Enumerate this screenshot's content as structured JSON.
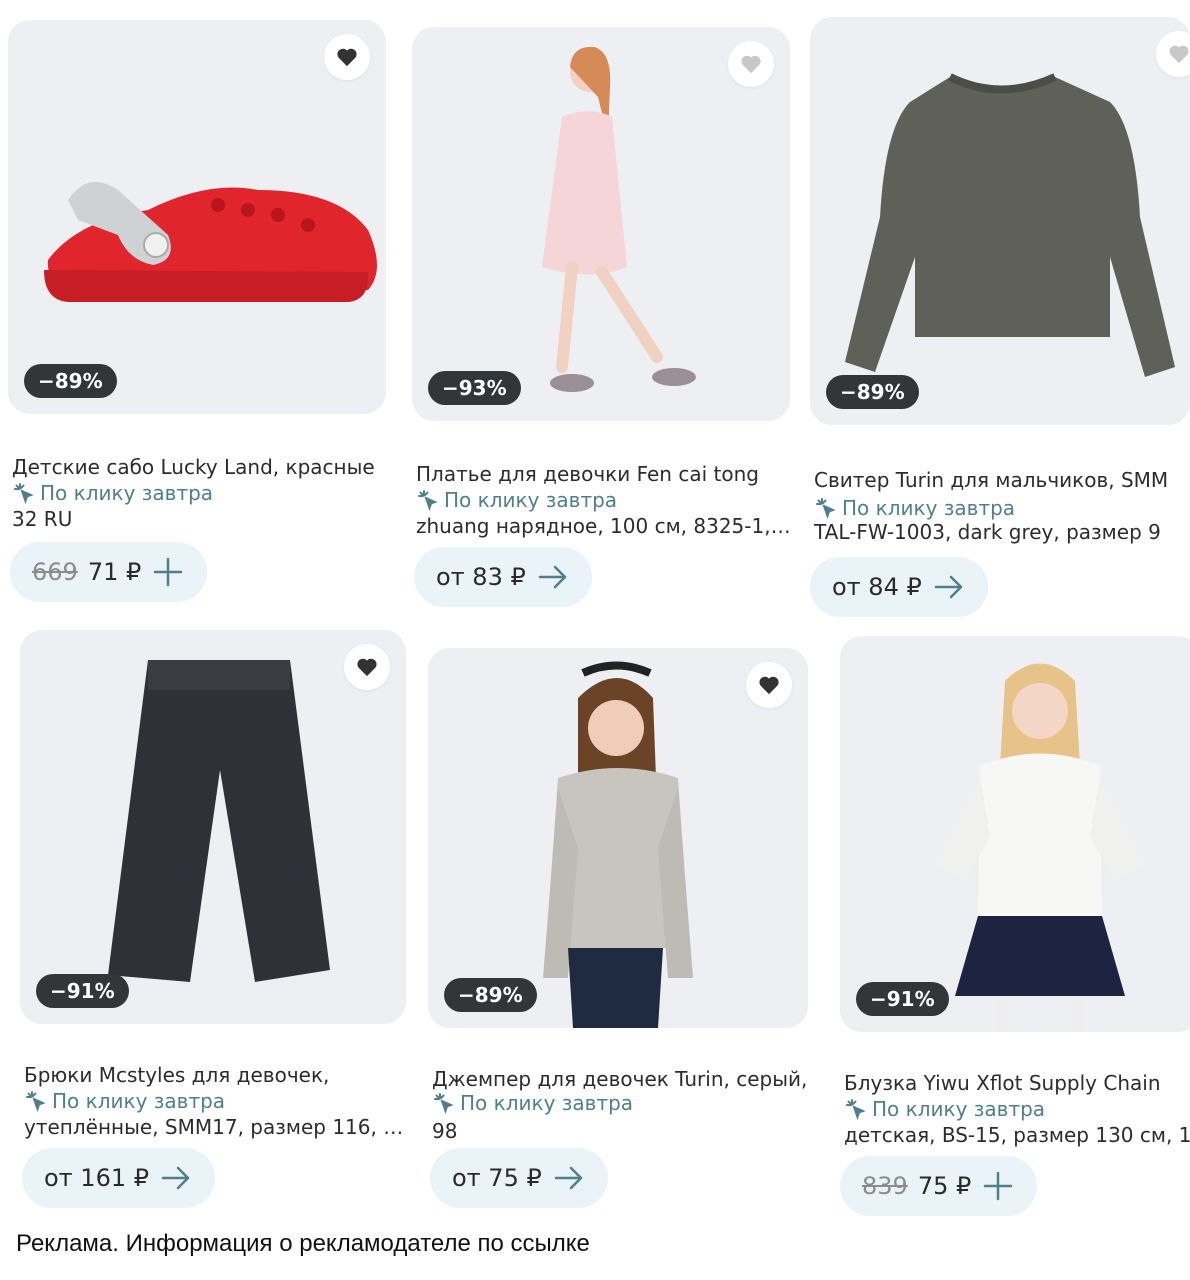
{
  "products": [
    {
      "discount": "−89%",
      "title_lines": [
        "Детские сабо Lucky Land, красные",
        "32 RU"
      ],
      "delivery": "По клику завтра",
      "price_old": "669",
      "price": "71 ₽",
      "action": "plus-icon"
    },
    {
      "discount": "−93%",
      "title_lines": [
        "Платье для девочки Fen cai tong",
        "zhuang нарядное, 100 см, 8325-1,…"
      ],
      "delivery": "По клику завтра",
      "price_old": "",
      "price": "от 83 ₽",
      "action": "arrow-right-icon"
    },
    {
      "discount": "−89%",
      "title_lines": [
        "Свитер Turin для мальчиков, SMM",
        "TAL-FW-1003, dark grey, размер 9"
      ],
      "delivery": "По клику завтра",
      "price_old": "",
      "price": "от 84 ₽",
      "action": "arrow-right-icon"
    },
    {
      "discount": "−91%",
      "title_lines": [
        "Брюки Mcstyles для девочек,",
        "утеплённые, SMM17, размер 116, 1…"
      ],
      "delivery": "По клику завтра",
      "price_old": "",
      "price": "от 161 ₽",
      "action": "arrow-right-icon"
    },
    {
      "discount": "−89%",
      "title_lines": [
        "Джемпер для девочек Turin, серый,",
        "98"
      ],
      "delivery": "По клику завтра",
      "price_old": "",
      "price": "от 75 ₽",
      "action": "arrow-right-icon"
    },
    {
      "discount": "−91%",
      "title_lines": [
        "Блузка Yiwu Xflot Supply Chain",
        "детская, BS-15, размер 130 см, 1"
      ],
      "delivery": "По клику завтра",
      "price_old": "839",
      "price": "75 ₽",
      "action": "plus-icon"
    }
  ],
  "footer": "Реклама. Информация о рекламодателе по ссылке",
  "colors": {
    "accent": "#4f7f8a",
    "pill_bg": "#eaf3f7",
    "badge_bg": "#333638"
  }
}
